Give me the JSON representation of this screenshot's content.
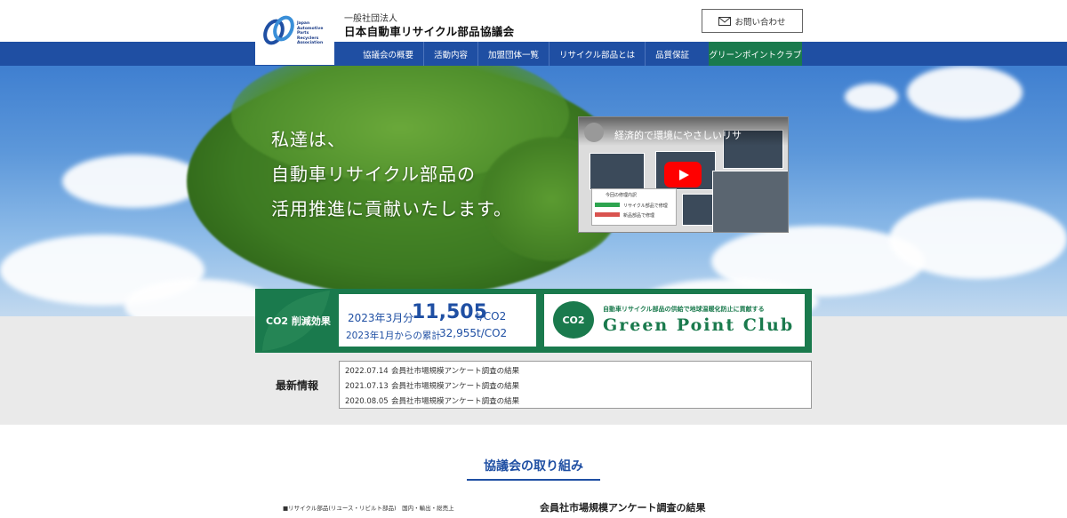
{
  "header": {
    "org_type": "一般社団法人",
    "org_name": "日本自動車リサイクル部品協議会",
    "logo_lines": [
      "Japan",
      "Automotive",
      "Parts",
      "Recyclers",
      "Association"
    ],
    "contact_label": "お問い合わせ"
  },
  "nav": {
    "items": [
      "協議会の概要",
      "活動内容",
      "加盟団体一覧",
      "リサイクル部品とは",
      "品質保証"
    ],
    "green_item": "グリーンポイントクラブ"
  },
  "hero": {
    "lines": [
      "私達は、",
      "自動車リサイクル部品の",
      "活用推進に貢献いたします。"
    ]
  },
  "video": {
    "title": "経済的で環境にやさしいリサ",
    "label_repair": "今回の修理内訳",
    "label_recycle": "リサイクル部品で修理",
    "label_new": "新品部品で修理"
  },
  "co2": {
    "label": "CO2 削減効果",
    "month": "2023年3月分",
    "value": "11,505",
    "unit": "t/CO2",
    "cumulative_label": "2023年1月からの累計",
    "cumulative_value": "32,955t/CO2"
  },
  "gpc": {
    "badge": "CO2",
    "tagline": "自動車リサイクル部品の供給で地球温暖化防止に貢献する",
    "name": "Green Point Club"
  },
  "news": {
    "title": "最新情報",
    "items": [
      {
        "date": "2022.07.14",
        "text": "会員社市場規模アンケート調査の結果"
      },
      {
        "date": "2021.07.13",
        "text": "会員社市場規模アンケート調査の結果"
      },
      {
        "date": "2020.08.05",
        "text": "会員社市場規模アンケート調査の結果"
      }
    ]
  },
  "section": {
    "title": "協議会の取り組み",
    "left_caption": "■リサイクル部品(リユース・リビルト部品)　国内・輸出・総売上",
    "right_heading": "会員社市場規模アンケート調査の結果"
  },
  "colors": {
    "nav_blue": "#1f4fa3",
    "green": "#1a7a4d",
    "youtube_red": "#ff0000"
  }
}
